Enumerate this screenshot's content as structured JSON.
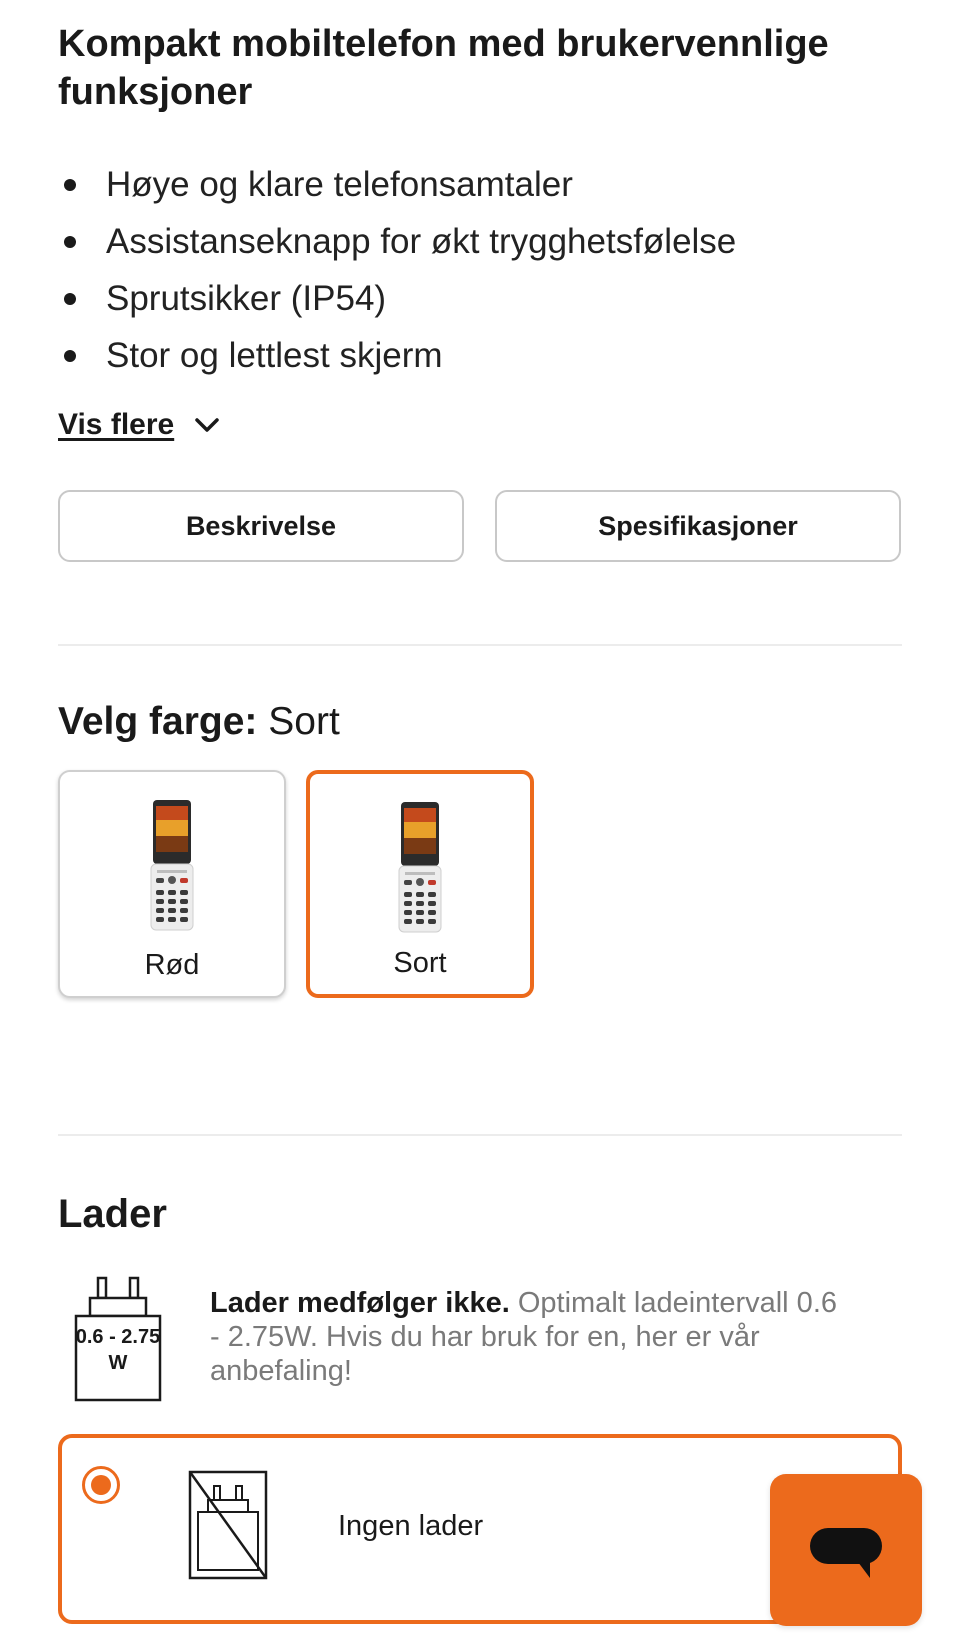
{
  "product": {
    "title": "Kompakt mobiltelefon med brukervennlige funksjoner",
    "features": [
      "Høye og klare telefonsamtaler",
      "Assistanseknapp for økt trygghetsfølelse",
      "Sprutsikker (IP54)",
      "Stor og lettlest skjerm"
    ],
    "show_more_label": "Vis flere",
    "show_more_icon": "chevron-down-icon"
  },
  "tabs": {
    "description_label": "Beskrivelse",
    "specifications_label": "Spesifikasjoner"
  },
  "color_picker": {
    "heading_label": "Velg farge:",
    "selected_value": "Sort",
    "options": [
      {
        "label": "Rød",
        "selected": false
      },
      {
        "label": "Sort",
        "selected": true
      }
    ]
  },
  "charger": {
    "heading": "Lader",
    "icon_text_line1": "0.6 - 2.75",
    "icon_text_line2": "W",
    "info_bold": "Lader medfølger ikke.",
    "info_text": "Optimalt ladeintervall 0.6 - 2.75W. Hvis du har bruk for en, her er vår anbefaling!",
    "option_label": "Ingen lader",
    "option_selected": true
  },
  "chat": {
    "icon": "chat-bubble-icon"
  },
  "colors": {
    "accent": "#ec6a1c",
    "text": "#1a1a1a",
    "muted_text": "#7a7a7a",
    "border": "#c8c8c8",
    "divider": "#ececec"
  }
}
